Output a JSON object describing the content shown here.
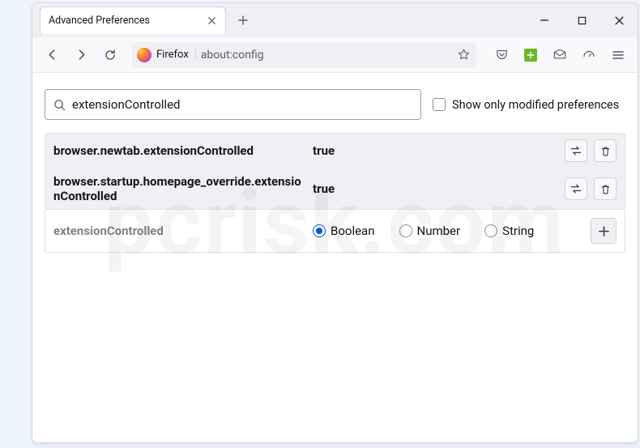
{
  "window": {
    "tab_title": "Advanced Preferences"
  },
  "toolbar": {
    "firefox_label": "Firefox",
    "url": "about:config"
  },
  "config": {
    "search_value": "extensionControlled",
    "checkbox_label": "Show only modified preferences",
    "rows": [
      {
        "name": "browser.newtab.extensionControlled",
        "value": "true"
      },
      {
        "name": "browser.startup.homepage_override.extensionControlled",
        "value": "true"
      }
    ],
    "new_pref_name": "extensionControlled",
    "type_options": [
      "Boolean",
      "Number",
      "String"
    ],
    "type_selected": "Boolean"
  },
  "watermark": "pcrisk.com"
}
